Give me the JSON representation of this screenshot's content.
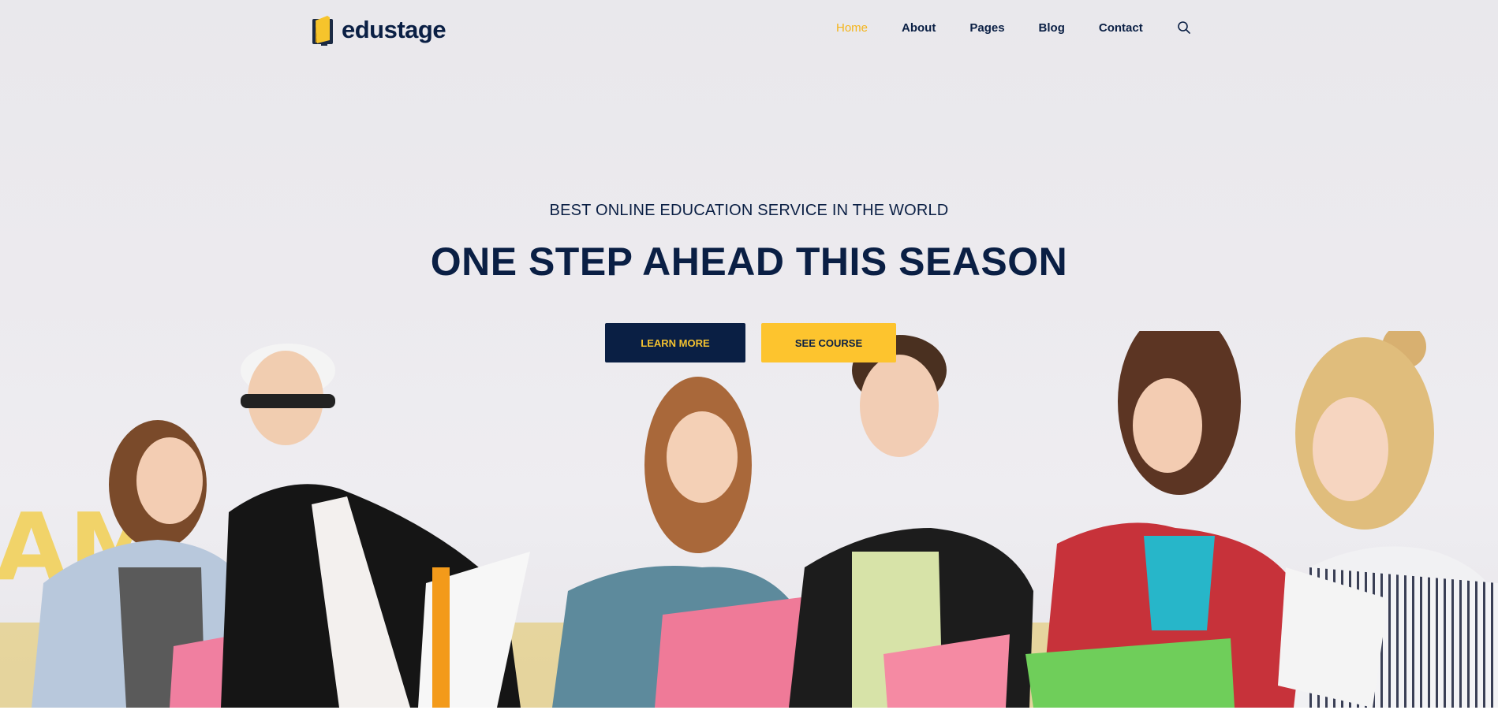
{
  "brand": {
    "name": "edustage"
  },
  "nav": {
    "items": [
      {
        "label": "Home",
        "active": true
      },
      {
        "label": "About",
        "active": false
      },
      {
        "label": "Pages",
        "active": false
      },
      {
        "label": "Blog",
        "active": false
      },
      {
        "label": "Contact",
        "active": false
      }
    ],
    "search_icon": "search-icon"
  },
  "hero": {
    "subtitle": "BEST ONLINE EDUCATION SERVICE IN THE WORLD",
    "title": "ONE STEP AHEAD THIS SEASON",
    "buttons": {
      "learn_more": "LEARN MORE",
      "see_course": "SEE COURSE"
    },
    "wall_text": "AM"
  },
  "colors": {
    "navy": "#0a1f44",
    "accent_yellow": "#fdc42e",
    "active_nav": "#f4b41a"
  }
}
